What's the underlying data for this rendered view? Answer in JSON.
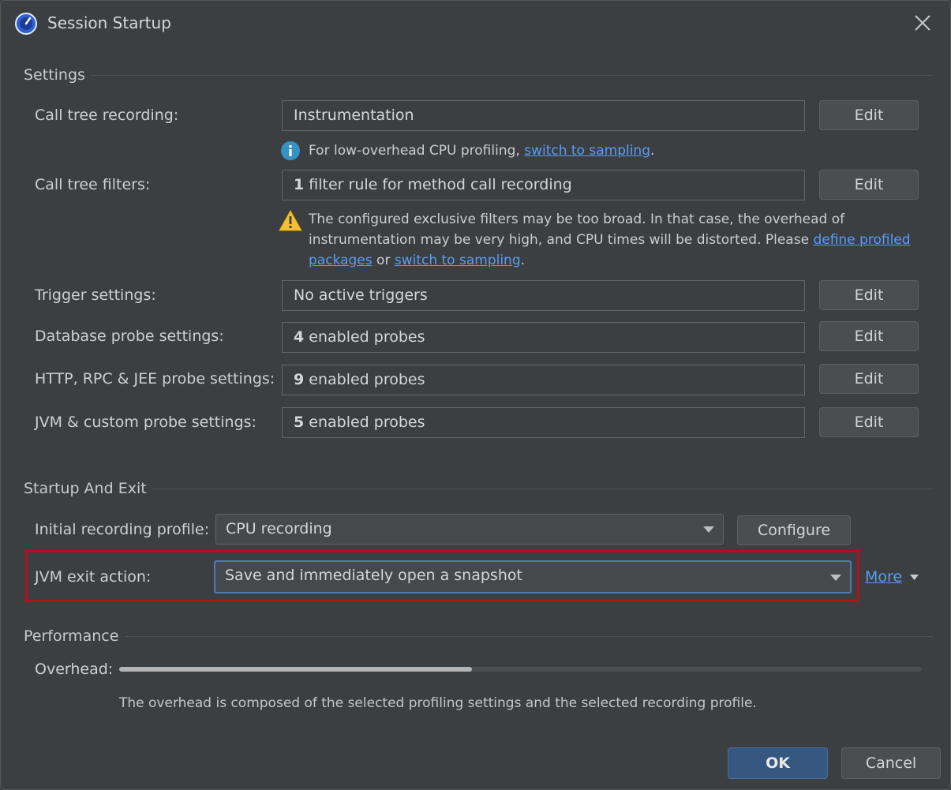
{
  "window": {
    "title": "Session Startup"
  },
  "sections": {
    "settings": "Settings",
    "startup": "Startup And Exit",
    "performance": "Performance"
  },
  "settings": {
    "call_tree_recording": {
      "label": "Call tree recording:",
      "value": "Instrumentation",
      "edit": "Edit"
    },
    "info_note": {
      "text": "For low-overhead CPU profiling, ",
      "link": "switch to sampling",
      "suffix": "."
    },
    "call_tree_filters": {
      "label": "Call tree filters:",
      "count": "1",
      "value": " filter rule for method call recording",
      "edit": "Edit"
    },
    "warning": {
      "line1": "The configured exclusive filters may be too broad. In that case, the overhead of",
      "line2": "instrumentation may be very high, and CPU times will be distorted. Please ",
      "link1a": "define profiled",
      "link1b": "packages",
      "mid": " or ",
      "link2": "switch to sampling",
      "suffix": "."
    },
    "trigger": {
      "label": "Trigger settings:",
      "value": "No active triggers",
      "edit": "Edit"
    },
    "database": {
      "label": "Database probe settings:",
      "count": "4",
      "value": " enabled probes",
      "edit": "Edit"
    },
    "http": {
      "label": "HTTP, RPC & JEE probe settings:",
      "count": "9",
      "value": " enabled probes",
      "edit": "Edit"
    },
    "jvm_custom": {
      "label": "JVM & custom probe settings:",
      "count": "5",
      "value": " enabled probes",
      "edit": "Edit"
    }
  },
  "startup": {
    "initial_profile": {
      "label": "Initial recording profile:",
      "value": "CPU recording",
      "button": "Configure"
    },
    "exit_action": {
      "label": "JVM exit action:",
      "value": "Save and immediately open a snapshot",
      "more": "More"
    }
  },
  "performance": {
    "overhead_label": "Overhead:",
    "overhead_fraction": 0.44,
    "description": "The overhead is composed of the selected profiling settings and the selected recording profile."
  },
  "footer": {
    "ok": "OK",
    "cancel": "Cancel"
  },
  "colors": {
    "accent": "#589df6",
    "highlight": "#b0121b",
    "ok_button": "#365880"
  }
}
